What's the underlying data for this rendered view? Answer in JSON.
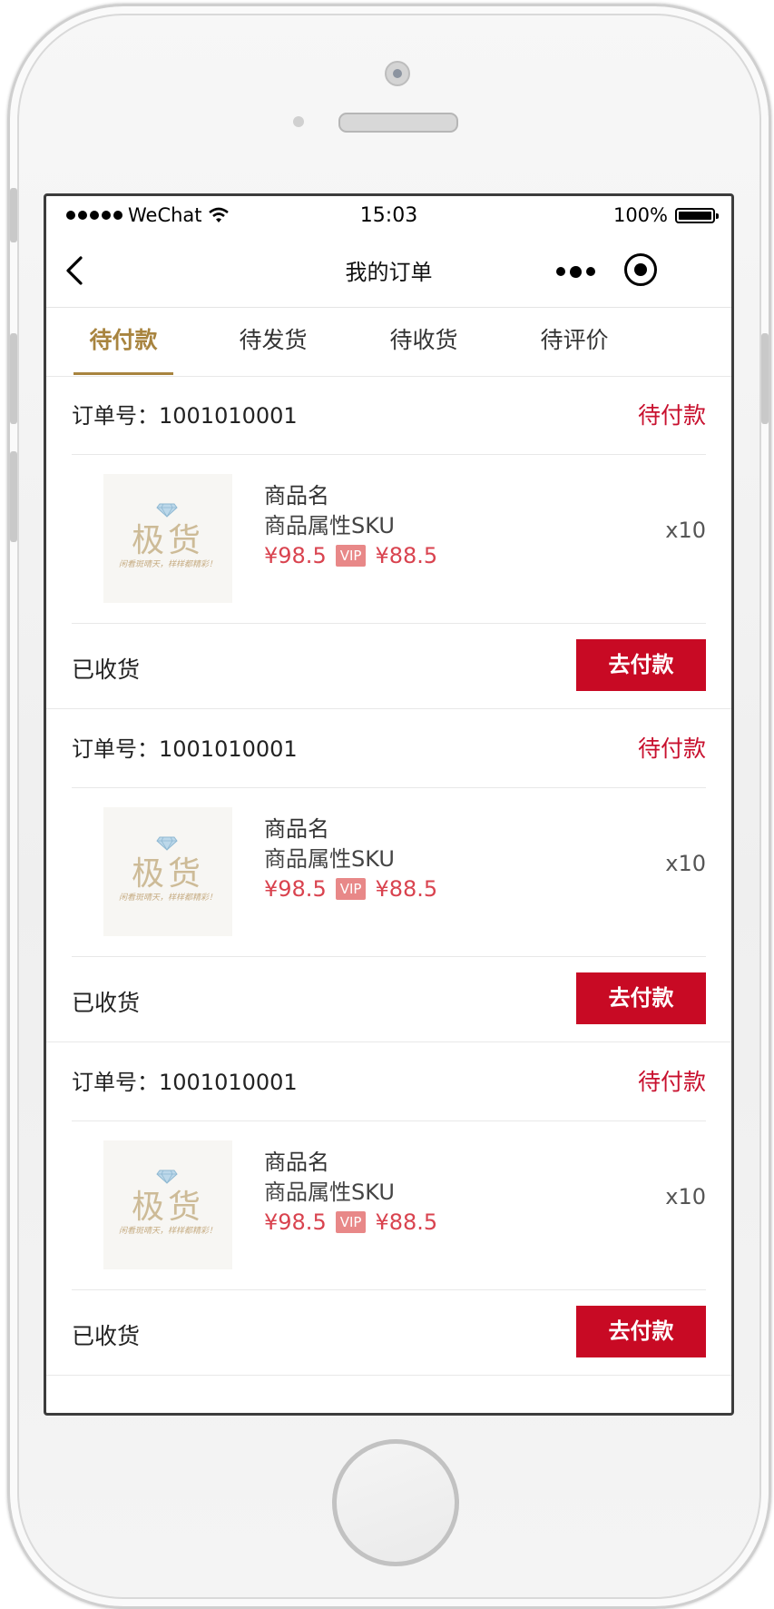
{
  "status_bar": {
    "carrier": "WeChat",
    "time": "15:03",
    "battery": "100%"
  },
  "nav": {
    "title": "我的订单"
  },
  "tabs": [
    {
      "label": "待付款",
      "active": true
    },
    {
      "label": "待发货",
      "active": false
    },
    {
      "label": "待收货",
      "active": false
    },
    {
      "label": "待评价",
      "active": false
    }
  ],
  "orders": [
    {
      "order_no": "订单号：1001010001",
      "status": "待付款",
      "item": {
        "thumb_logo": "极货",
        "thumb_slogan": "闲看斑晴天，样样都精彩！",
        "name": "商品名",
        "sku": "商品属性SKU",
        "price": "¥98.5",
        "vip_label": "VIP",
        "vip_price": "¥88.5",
        "quantity": "x10"
      },
      "footer_text": "已收货",
      "action_label": "去付款"
    },
    {
      "order_no": "订单号：1001010001",
      "status": "待付款",
      "item": {
        "thumb_logo": "极货",
        "thumb_slogan": "闲看斑晴天，样样都精彩！",
        "name": "商品名",
        "sku": "商品属性SKU",
        "price": "¥98.5",
        "vip_label": "VIP",
        "vip_price": "¥88.5",
        "quantity": "x10"
      },
      "footer_text": "已收货",
      "action_label": "去付款"
    },
    {
      "order_no": "订单号：1001010001",
      "status": "待付款",
      "item": {
        "thumb_logo": "极货",
        "thumb_slogan": "闲看斑晴天，样样都精彩！",
        "name": "商品名",
        "sku": "商品属性SKU",
        "price": "¥98.5",
        "vip_label": "VIP",
        "vip_price": "¥88.5",
        "quantity": "x10"
      },
      "footer_text": "已收货",
      "action_label": "去付款"
    }
  ],
  "colors": {
    "accent": "#a8843f",
    "primary_red": "#c80a24",
    "price_red": "#d9434f",
    "vip_badge": "#e88888"
  }
}
